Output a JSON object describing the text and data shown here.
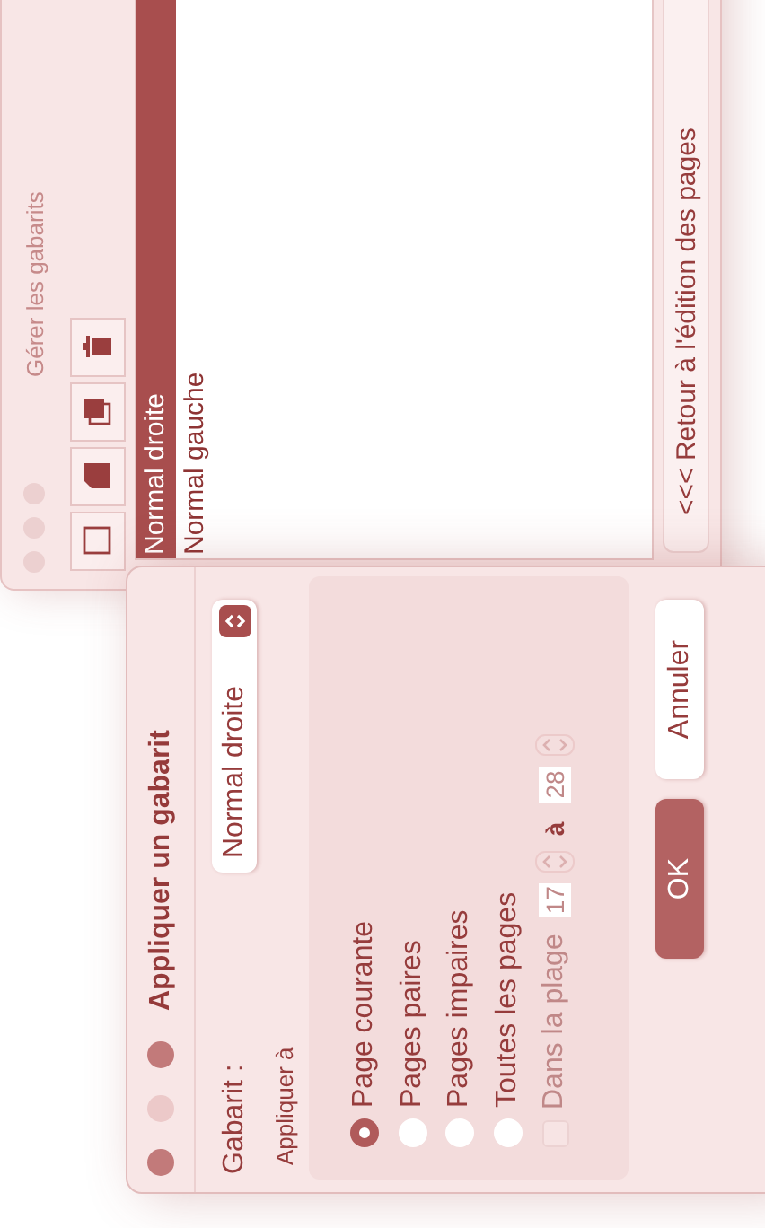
{
  "manager_window": {
    "title": "Gérer les gabarits",
    "templates": [
      {
        "name": "Normal droite",
        "selected": true
      },
      {
        "name": "Normal gauche",
        "selected": false
      }
    ],
    "back_button": "<<< Retour à l'édition des pages"
  },
  "dialog": {
    "title": "Appliquer un gabarit",
    "template_label": "Gabarit :",
    "template_popup": "Normal droite",
    "apply_to_label": "Appliquer à",
    "options": [
      {
        "label": "Page courante",
        "selected": true
      },
      {
        "label": "Pages paires",
        "selected": false
      },
      {
        "label": "Pages impaires",
        "selected": false
      },
      {
        "label": "Toutes les pages",
        "selected": false
      }
    ],
    "range": {
      "label": "Dans la plage",
      "checked": false,
      "disabled": true,
      "from": "17",
      "separator": "à",
      "to": "28"
    },
    "buttons": [
      {
        "label": "OK",
        "kind": "primary"
      },
      {
        "label": "Annuler",
        "kind": "secondary"
      }
    ]
  }
}
